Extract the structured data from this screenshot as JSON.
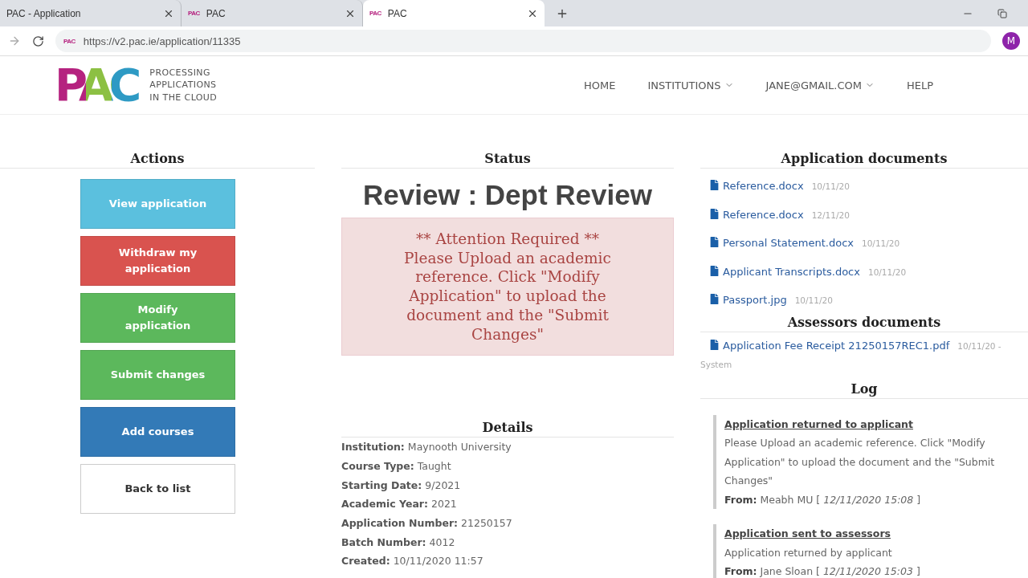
{
  "browser": {
    "tabs": [
      {
        "title": "PAC - Application",
        "selected": false
      },
      {
        "title": "PAC",
        "favicon": "PAC",
        "selected": false
      },
      {
        "title": "PAC",
        "favicon": "PAC",
        "selected": true
      }
    ],
    "url": "https://v2.pac.ie/application/11335",
    "favicon": "PAC",
    "avatar": "M"
  },
  "header": {
    "logo": "PAC",
    "tagline": [
      "PROCESSING",
      "APPLICATIONS",
      "IN THE CLOUD"
    ],
    "nav": [
      {
        "label": "HOME",
        "dropdown": false
      },
      {
        "label": "INSTITUTIONS",
        "dropdown": true
      },
      {
        "label": "JANE@GMAIL.COM",
        "dropdown": true
      },
      {
        "label": "HELP",
        "dropdown": false
      }
    ]
  },
  "actions": {
    "title": "Actions",
    "buttons": [
      {
        "label": "View application",
        "color": "#5bc0de"
      },
      {
        "label": "Withdraw my application",
        "color": "#d9534f"
      },
      {
        "label": "Modify application",
        "color": "#5cb85c"
      },
      {
        "label": "Submit changes",
        "color": "#5cb85c"
      },
      {
        "label": "Add courses",
        "color": "#337ab7"
      },
      {
        "label": "Back to list",
        "color": "#ffffff"
      }
    ]
  },
  "status": {
    "title": "Status",
    "state": "Review : Dept Review",
    "alert": {
      "heading": "** Attention Required **",
      "message": "Please Upload an academic reference. Click \"Modify Application\" to upload the document and the \"Submit Changes\""
    }
  },
  "details": {
    "title": "Details",
    "rows": [
      "**Institution:** Maynooth University",
      "**Course Type:** Taught",
      "**Starting Date:** 9/2021",
      "**Academic Year:** 2021",
      "**Application Number:** 21250157",
      "**Batch Number:** 4012",
      "**Created:** 10/11/2020 11:57"
    ]
  },
  "application_documents": {
    "title": "Application documents",
    "items": [
      {
        "name": "Reference.docx",
        "date": "10/11/20"
      },
      {
        "name": "Reference.docx",
        "date": "12/11/20"
      },
      {
        "name": "Personal Statement.docx",
        "date": "10/11/20"
      },
      {
        "name": "Applicant Transcripts.docx",
        "date": "10/11/20"
      },
      {
        "name": "Passport.jpg",
        "date": "10/11/20"
      }
    ]
  },
  "assessors_documents": {
    "title": "Assessors documents",
    "items": [
      {
        "name": "Application Fee Receipt 21250157REC1.pdf",
        "date": "10/11/20 -",
        "uploader": "System"
      }
    ]
  },
  "log": {
    "title": "Log",
    "entries": [
      {
        "title": "Application returned to applicant",
        "message": "Please Upload an academic reference. Click \"Modify Application\" to upload the document and the \"Submit Changes\"",
        "from": "**From:** Meabh MU [ *12/11/2020 15:08* ]"
      },
      {
        "title": "Application sent to assessors",
        "message": "Application returned by applicant",
        "from": "**From:** Jane Sloan [ *12/11/2020 15:03* ]"
      }
    ]
  }
}
